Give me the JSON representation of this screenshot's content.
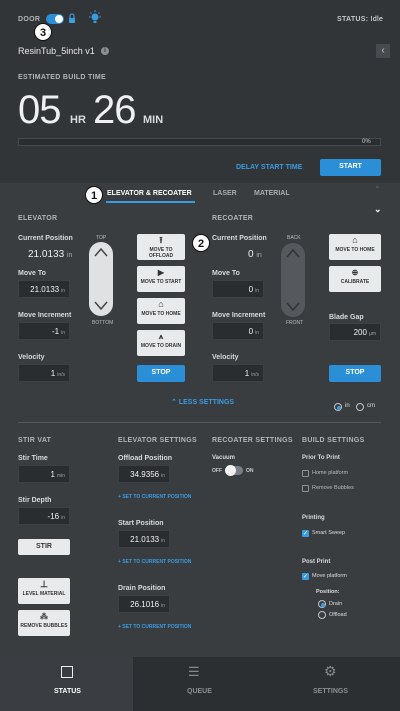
{
  "header": {
    "door_label": "DOOR",
    "status_label": "STATUS:",
    "status_value": "Idle",
    "file_name": "ResinTub_5inch v1",
    "collapse_glyph": "‹",
    "est_label": "ESTIMATED BUILD TIME",
    "hours": "05",
    "hr_unit": "HR",
    "minutes": "26",
    "min_unit": "MIN",
    "progress_text": "0%",
    "progress": 0,
    "delay_label": "DELAY START TIME",
    "start_label": "START"
  },
  "tabs": [
    {
      "label": "ELEVATOR & RECOATER"
    },
    {
      "label": "LASER"
    },
    {
      "label": "MATERIAL"
    }
  ],
  "badges": [
    "1",
    "2",
    "3"
  ],
  "elevator": {
    "title": "ELEVATOR",
    "current_label": "Current Position",
    "current_value": "21.0133",
    "current_unit": "in",
    "move_label": "Move To",
    "move_value": "21.0133",
    "move_unit": "in",
    "incr_label": "Move Increment",
    "incr_value": "-1",
    "incr_unit": "in",
    "vel_label": "Velocity",
    "vel_value": "1",
    "vel_unit": "in/s",
    "top_label": "TOP",
    "bottom_label": "BOTTOM",
    "btn_offload": "MOVE TO OFFLOAD",
    "btn_start": "MOVE TO START",
    "btn_home": "MOVE TO HOME",
    "btn_drain": "MOVE TO DRAIN",
    "stop": "STOP"
  },
  "recoater": {
    "title": "RECOATER",
    "current_label": "Current Position",
    "current_value": "0",
    "current_unit": "in",
    "move_label": "Move To",
    "move_value": "0",
    "move_unit": "in",
    "incr_label": "Move Increment",
    "incr_value": "0",
    "incr_unit": "in",
    "vel_label": "Velocity",
    "vel_value": "1",
    "vel_unit": "in/s",
    "back_label": "BACK",
    "front_label": "FRONT",
    "btn_home": "MOVE TO HOME",
    "btn_calibrate": "CALIBRATE",
    "gap_label": "Blade Gap",
    "gap_value": "200",
    "gap_unit": "µm",
    "stop": "STOP"
  },
  "less_settings": "LESS SETTINGS",
  "units": {
    "in": "in",
    "cm": "cm"
  },
  "stir": {
    "title": "STIR VAT",
    "time_label": "Stir Time",
    "time_value": "1",
    "time_unit": "min",
    "depth_label": "Stir Depth",
    "depth_value": "-16",
    "depth_unit": "in",
    "stir_btn": "STIR",
    "level_btn": "LEVEL MATERIAL",
    "bubbles_btn": "REMOVE BUBBLES"
  },
  "elev_settings": {
    "title": "ELEVATOR SETTINGS",
    "offload_label": "Offload Position",
    "offload_value": "34.9356",
    "start_label": "Start Position",
    "start_value": "21.0133",
    "drain_label": "Drain Position",
    "drain_value": "26.1016",
    "unit": "in",
    "set_link": "SET TO CURRENT POSITION"
  },
  "recoater_settings": {
    "title": "RECOATER SETTINGS",
    "vacuum_label": "Vacuum",
    "off": "OFF",
    "on": "ON"
  },
  "build_settings": {
    "title": "BUILD SETTINGS",
    "prior_label": "Prior To Print",
    "home_platform": "Home platform",
    "remove_bubbles": "Remove Bubbles",
    "printing_label": "Printing",
    "smart_sweep": "Smart Sweep",
    "post_label": "Post Print",
    "move_platform": "Move platform",
    "position_label": "Position:",
    "drain": "Drain",
    "offload": "Offload"
  },
  "nav": {
    "status": "STATUS",
    "queue": "QUEUE",
    "settings": "SETTINGS"
  }
}
